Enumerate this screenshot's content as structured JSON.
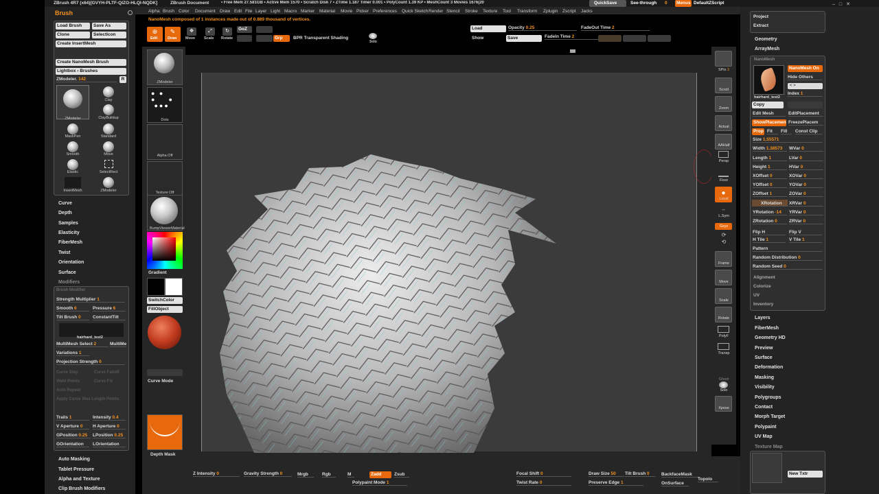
{
  "titlebar": {
    "app": "ZBrush 4R7 (x64)[GVYH-PLTF-QIZO-HLQI-NQDK]",
    "doc": "ZBrush Document",
    "stats": "• Free Mem 27.581GB • Active Mem 1570 • Scratch Disk 7 • ZTime 1.187 Timer 0.001 • PolyCount 1.39 KP • MeshCount 3 Movies 1676(20",
    "quicksave": "QuickSave",
    "seethrough": "See-through",
    "seethrough_val": "0",
    "menus": "Menus",
    "defaultzscript": "DefaultZScript"
  },
  "top_menu": [
    "Alpha",
    "Brush",
    "Color",
    "Document",
    "Draw",
    "Edit",
    "File",
    "Layer",
    "Light",
    "Macro",
    "Marker",
    "Material",
    "Movie",
    "Picker",
    "Preferences",
    "Render",
    "Stencil",
    "Stroke",
    "Texture",
    "Tool",
    "Transform",
    "Zplugin",
    "Zscript",
    "Jacks"
  ],
  "top_menu_extra": "Quick Sketch",
  "message": "NanoMesh composed of 1 instances made out of 0.889 thousand of vertices.",
  "toolbar": {
    "edit": "Edit",
    "draw": "Draw",
    "move": "Move",
    "scale": "Scale",
    "rotate": "Rotate",
    "goz": "GoZ",
    "grp": "Grp",
    "bpr": "BPR Transparent Shading",
    "solo": "Solo",
    "load": "Load",
    "save": "Save",
    "show": "Show",
    "opacity_label": "Opacity",
    "opacity_val": "0.25",
    "fadeout_label": "FadeOut Time",
    "fadeout_val": "2",
    "fadein_label": "FadeIn Time",
    "fadein_val": "2"
  },
  "brush_palette": {
    "title": "Brush",
    "buttons": [
      "Load Brush",
      "Save As",
      "Clone",
      "SelectIcon",
      "Create InsertMesh",
      "Create NanoMesh Brush",
      "Lightbox › Brushes"
    ],
    "zmodeler_label": "ZModeler.",
    "zmodeler_val": "142",
    "r": "R",
    "brushes": [
      "ZModeler",
      "Clay",
      "ClayBuildup",
      "MaskPen",
      "Standard",
      "Smooth",
      "Move",
      "Elastic",
      "SelectRect",
      "InsertMesh",
      "ZModeler"
    ],
    "subpalettes": [
      "Curve",
      "Depth",
      "Samples",
      "Elasticity",
      "FiberMesh",
      "Twist",
      "Orientation",
      "Surface"
    ],
    "modifiers_title": "Modifiers",
    "brush_modifier": "Brush Modifier",
    "strength_multiplier": "Strength Multiplier",
    "strength_multiplier_val": "1",
    "smooth": "Smooth",
    "smooth_val": "6",
    "pressure": "Pressure",
    "pressure_val": "6",
    "tilt_brush": "Tilt Brush",
    "tilt_brush_val": "0",
    "constant_tilt": "ConstantTilt",
    "insert_name": "hairhard_test2",
    "multimesh_select": "MultiMesh Select",
    "multimesh_select_val": "2",
    "multimesh": "MultiMe",
    "variations": "Variations",
    "variations_val": "1",
    "projection_strength": "Projection Strength",
    "projection_strength_val": "0",
    "dim_items": [
      "Curve Step",
      "Curve Falloff",
      "Weld Points",
      "Curve Fix",
      "Auto Repeat",
      "Apply Curve",
      "Max Length Points"
    ],
    "trails": "Trails",
    "trails_val": "1",
    "intensity": "Intensity",
    "intensity_val": "0.4",
    "v_aperture": "V Aperture",
    "v_aperture_val": "0",
    "h_aperture": "H Aperture",
    "h_aperture_val": "0",
    "gposition": "GPosition",
    "gposition_val": "0.25",
    "lposition": "LPosition",
    "lposition_val": "0.25",
    "gorientation": "GOrientation",
    "lorientation": "LOrientation",
    "bottom": [
      "Auto Masking",
      "Tablet Pressure",
      "Alpha and Texture",
      "Clip Brush Modifiers"
    ]
  },
  "left_shelf": {
    "zmodeler": "ZModeler",
    "dots": "Dots",
    "alpha": "Alpha Off",
    "texture": "Texture Off",
    "material": "BumpViewerMaterial",
    "gradient": "Gradient",
    "switchcolor": "SwitchColor",
    "fillobject": "FillObject",
    "curve_mode": "Curve Mode",
    "depth_mask": "Depth Mask"
  },
  "right_shelf": [
    "SPix",
    "Scroll",
    "Zoom",
    "Actual",
    "AAHalf",
    "Persp",
    "Floor",
    "Local",
    "L.Sym",
    "Gxyz",
    "Frame",
    "Move",
    "Scale",
    "Rotate",
    "PolyF",
    "Transp",
    "Ghost",
    "Solo",
    "Xpose"
  ],
  "right_shelf_spix_val": "3",
  "tool_palette": {
    "top": [
      "Project",
      "Extract"
    ],
    "items": [
      "Geometry",
      "ArrayMesh"
    ],
    "nanomesh": "NanoMesh",
    "nanomesh_on": "NanoMesh On",
    "hide_others": "Hide Others",
    "index_label": "Index",
    "index_val": "1",
    "thumb_name": "hairhard_test2",
    "copy": "Copy",
    "edit_mesh": "Edit Mesh",
    "edit_placement": "EditPlacement",
    "show_placement": "ShowPlacement",
    "freeze_placement": "FreezePlacem",
    "prop": "Prop",
    "fit": "Fit",
    "fill": "Fill",
    "const_clip": "Const Clip",
    "size_label": "Size",
    "size_val": "1.55571",
    "sliders": [
      {
        "l": "Width",
        "v": "1.38573",
        "r": "WVar",
        "rv": "0"
      },
      {
        "l": "Length",
        "v": "1",
        "r": "LVar",
        "rv": "0"
      },
      {
        "l": "Height",
        "v": "1",
        "r": "HVar",
        "rv": "0"
      },
      {
        "l": "XOffset",
        "v": "0",
        "r": "XOVar",
        "rv": "0"
      },
      {
        "l": "YOffset",
        "v": "0",
        "r": "YOVar",
        "rv": "0"
      },
      {
        "l": "ZOffset",
        "v": "1",
        "r": "ZOVar",
        "rv": "0"
      },
      {
        "l": "XRotation",
        "v": "",
        "r": "XRVar",
        "rv": "0"
      },
      {
        "l": "YRotation",
        "v": "-14",
        "r": "YRVar",
        "rv": "0"
      },
      {
        "l": "ZRotation",
        "v": "0",
        "r": "ZRVar",
        "rv": "0"
      }
    ],
    "flip_h": "Flip H",
    "flip_v": "Flip V",
    "h_tile": "H Tile",
    "h_tile_val": "1",
    "v_tile": "V Tile",
    "v_tile_val": "1",
    "pattern": "Pattern",
    "random_distribution": "Random Distribution",
    "random_distribution_val": "0",
    "random_seed": "Random Seed",
    "random_seed_val": "0",
    "sub": [
      "Alignment",
      "Colorize",
      "UV",
      "Inventory"
    ],
    "lower": [
      "Layers",
      "FiberMesh",
      "Geometry HD",
      "Preview",
      "Surface",
      "Deformation",
      "Masking",
      "Visibility",
      "Polygroups",
      "Contact",
      "Morph Target",
      "Polypaint",
      "UV Map",
      "Texture Map"
    ],
    "new_txtr": "New Txtr"
  },
  "bottom_bar": {
    "z_intensity": "Z Intensity",
    "z_intensity_val": "0",
    "gravity_strength": "Gravity Strength",
    "gravity_strength_val": "0",
    "mrgb": "Mrgb",
    "rgb": "Rgb",
    "m": "M",
    "zadd": "Zadd",
    "zsub": "Zsub",
    "polypaint_mode": "Polypaint Mode",
    "polypaint_mode_val": "1",
    "focal_shift": "Focal Shift",
    "focal_shift_val": "0",
    "twist_rate": "Twist Rate",
    "twist_rate_val": "0",
    "draw_size": "Draw Size",
    "draw_size_val": "50",
    "tilt_brush": "Tilt Brush",
    "tilt_brush_val": "0",
    "preserve_edge": "Preserve Edge",
    "preserve_edge_val": "1",
    "backfacemask": "BackfaceMask",
    "onsurface": "OnSurface",
    "topolo": "Topolo"
  },
  "colors": {
    "accent": "#e8680c",
    "value": "#f7931e",
    "panel": "#2f2f2f",
    "canvas": "#3b3b3b"
  }
}
